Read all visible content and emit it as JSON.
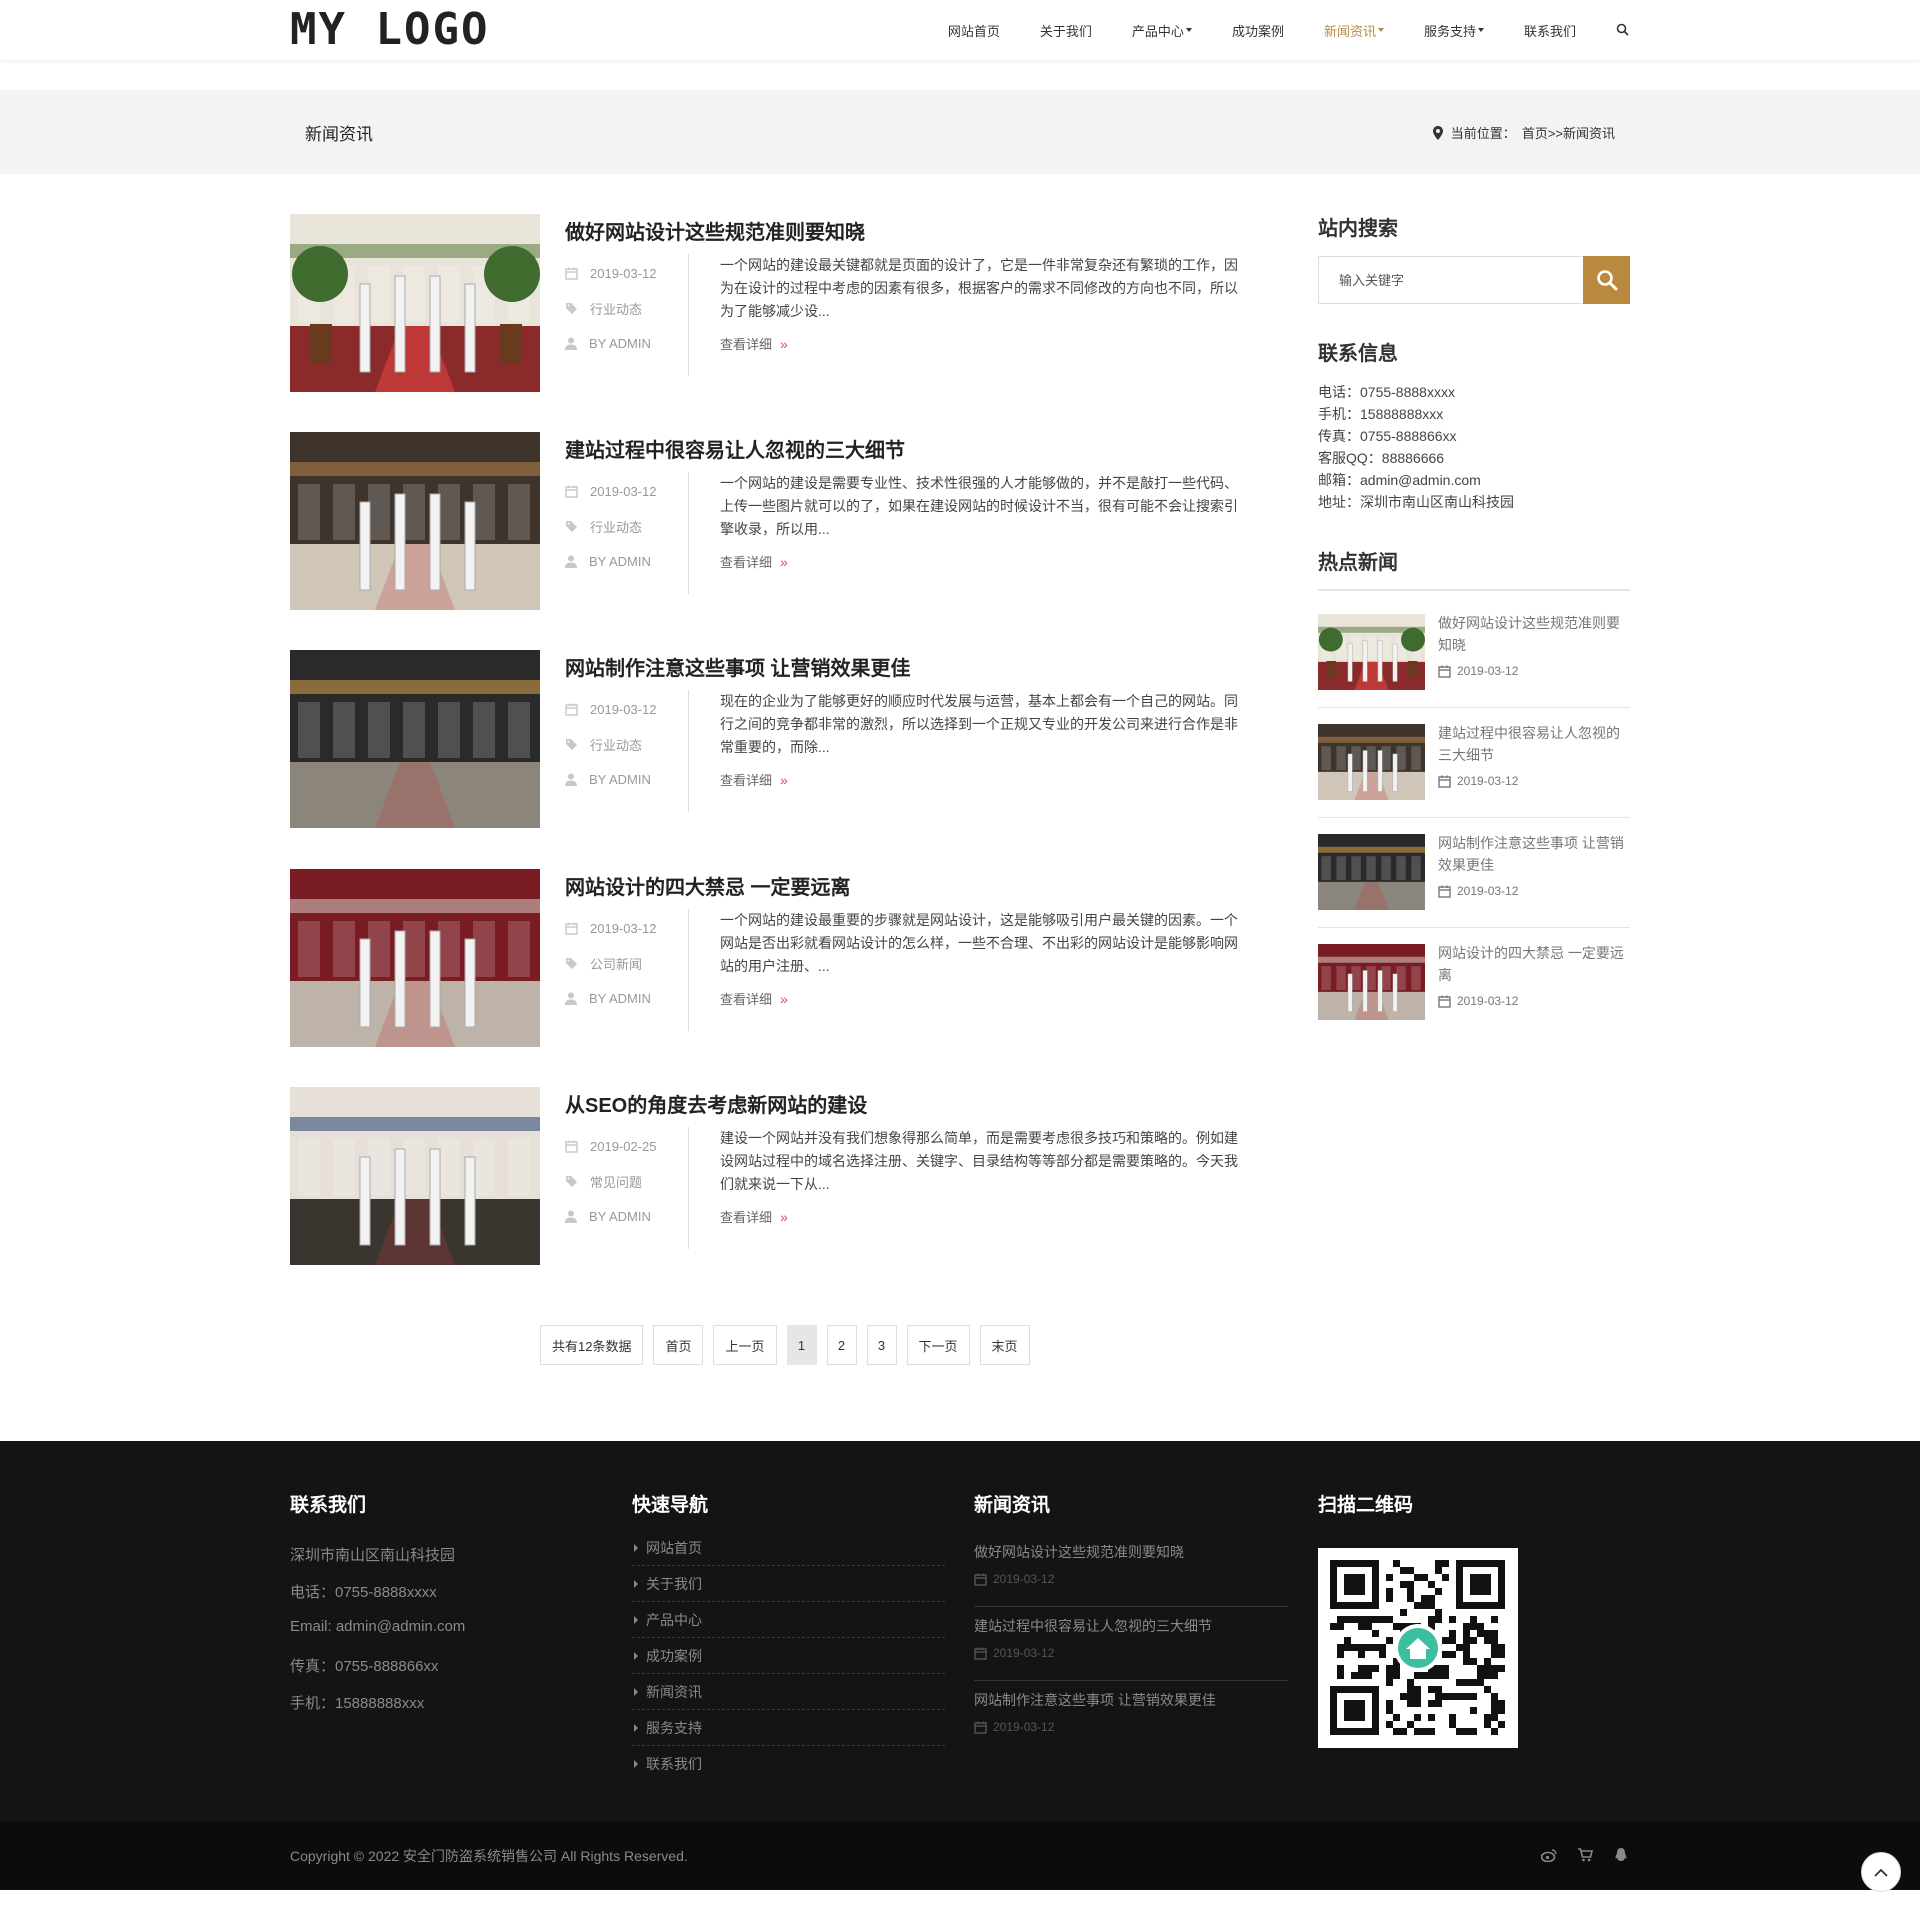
{
  "header": {
    "logo": "MY LOGO",
    "nav": [
      "网站首页",
      "关于我们",
      "产品中心",
      "成功案例",
      "新闻资讯",
      "服务支持",
      "联系我们"
    ],
    "active_index": 4
  },
  "banner": {
    "title": "新闻资讯",
    "breadcrumb_prefix": "当前位置：",
    "breadcrumb_path": "首页>>新闻资讯"
  },
  "articles": [
    {
      "title": "做好网站设计这些规范准则要知晓",
      "date": "2019-03-12",
      "category": "行业动态",
      "author": "BY ADMIN",
      "excerpt": "一个网站的建设最关键都就是页面的设计了，它是一件非常复杂还有繁琐的工作，因为在设计的过程中考虑的因素有很多，根据客户的需求不同修改的方向也不同，所以为了能够减少设...",
      "readmore": "查看详细"
    },
    {
      "title": "建站过程中很容易让人忽视的三大细节",
      "date": "2019-03-12",
      "category": "行业动态",
      "author": "BY ADMIN",
      "excerpt": "一个网站的建设是需要专业性、技术性很强的人才能够做的，并不是敲打一些代码、上传一些图片就可以的了，如果在建设网站的时候设计不当，很有可能不会让搜索引擎收录，所以用...",
      "readmore": "查看详细"
    },
    {
      "title": "网站制作注意这些事项 让营销效果更佳",
      "date": "2019-03-12",
      "category": "行业动态",
      "author": "BY ADMIN",
      "excerpt": "现在的企业为了能够更好的顺应时代发展与运营，基本上都会有一个自己的网站。同行之间的竞争都非常的激烈，所以选择到一个正规又专业的开发公司来进行合作是非常重要的，而除...",
      "readmore": "查看详细"
    },
    {
      "title": "网站设计的四大禁忌 一定要远离",
      "date": "2019-03-12",
      "category": "公司新闻",
      "author": "BY ADMIN",
      "excerpt": "一个网站的建设最重要的步骤就是网站设计，这是能够吸引用户最关键的因素。一个网站是否出彩就看网站设计的怎么样，一些不合理、不出彩的网站设计是能够影响网站的用户注册、...",
      "readmore": "查看详细"
    },
    {
      "title": "从SEO的角度去考虑新网站的建设",
      "date": "2019-02-25",
      "category": "常见问题",
      "author": "BY ADMIN",
      "excerpt": "建设一个网站并没有我们想象得那么简单，而是需要考虑很多技巧和策略的。例如建设网站过程中的域名选择注册、关键字、目录结构等等部分都是需要策略的。今天我们就来说一下从...",
      "readmore": "查看详细"
    }
  ],
  "pagination": {
    "total": "共有12条数据",
    "first": "首页",
    "prev": "上一页",
    "pages": [
      "1",
      "2",
      "3"
    ],
    "current": "1",
    "next": "下一页",
    "last": "末页"
  },
  "sidebar": {
    "search_heading": "站内搜索",
    "search_placeholder": "输入关键字",
    "contact_heading": "联系信息",
    "contact": [
      "电话：0755-8888xxxx",
      "手机：15888888xxx",
      "传真：0755-888866xx",
      "客服QQ：88886666",
      "邮箱：admin@admin.com",
      "地址：深圳市南山区南山科技园"
    ],
    "hot_heading": "热点新闻",
    "hot": [
      {
        "title": "做好网站设计这些规范准则要知晓",
        "date": "2019-03-12"
      },
      {
        "title": "建站过程中很容易让人忽视的三大细节",
        "date": "2019-03-12"
      },
      {
        "title": "网站制作注意这些事项 让营销效果更佳",
        "date": "2019-03-12"
      },
      {
        "title": "网站设计的四大禁忌 一定要远离",
        "date": "2019-03-12"
      }
    ]
  },
  "footer": {
    "contact_heading": "联系我们",
    "contact": [
      "深圳市南山区南山科技园",
      "电话：0755-8888xxxx",
      "Email: admin@admin.com",
      "传真：0755-888866xx",
      "手机：15888888xxx"
    ],
    "nav_heading": "快速导航",
    "nav": [
      "网站首页",
      "关于我们",
      "产品中心",
      "成功案例",
      "新闻资讯",
      "服务支持",
      "联系我们"
    ],
    "news_heading": "新闻资讯",
    "news": [
      {
        "title": "做好网站设计这些规范准则要知晓",
        "date": "2019-03-12"
      },
      {
        "title": "建站过程中很容易让人忽视的三大细节",
        "date": "2019-03-12"
      },
      {
        "title": "网站制作注意这些事项 让营销效果更佳",
        "date": "2019-03-12"
      }
    ],
    "qr_heading": "扫描二维码",
    "copyright": "Copyright © 2022 安全门防盗系统销售公司 All Rights Reserved."
  },
  "colors": {
    "accent": "#b8893f",
    "nav_active": "#b88a4a",
    "footer_bg": "#141414"
  },
  "icons": [
    "search-icon",
    "map-pin-icon",
    "calendar-icon",
    "tag-icon",
    "user-icon",
    "weibo-icon",
    "cart-icon",
    "qq-icon",
    "arrow-up-icon"
  ]
}
